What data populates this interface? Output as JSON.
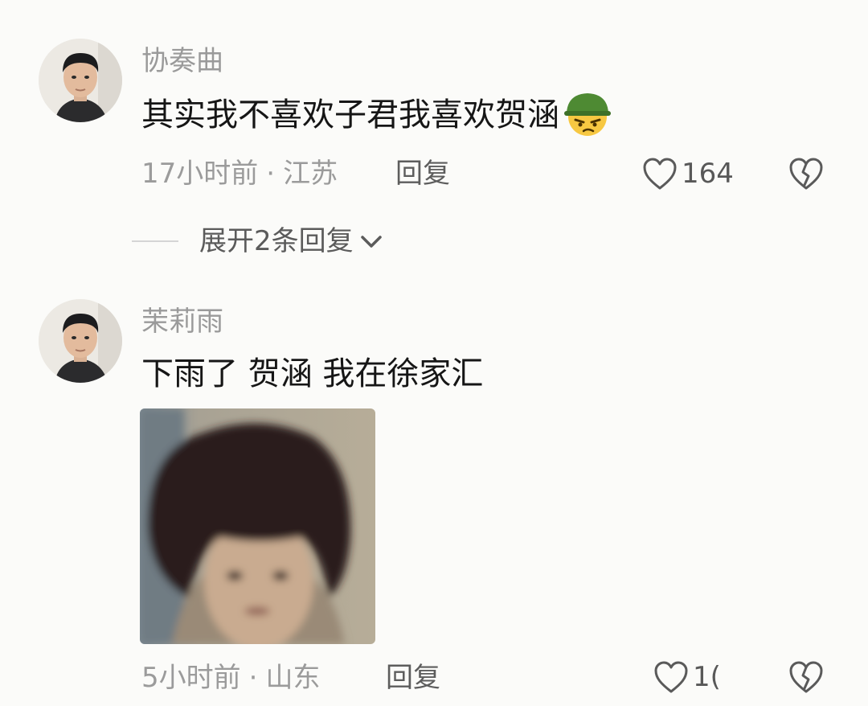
{
  "comments": [
    {
      "username": "协奏曲",
      "text": "其实我不喜欢子君我喜欢贺涵",
      "emoji": "soldier-helmet-frowning-emoji",
      "time": "17小时前",
      "location": "江苏",
      "reply_label": "回复",
      "like_count": "164",
      "expand_label": "展开2条回复"
    },
    {
      "username": "茉莉雨",
      "text": "下雨了 贺涵 我在徐家汇",
      "attachment": "photo-person-with-bob-haircut",
      "time": "5小时前",
      "location": "山东",
      "reply_label": "回复",
      "like_count": "1("
    }
  ],
  "separator": "·",
  "icons": {
    "like": "heart-outline-icon",
    "dislike": "broken-heart-icon",
    "expand": "chevron-down-icon"
  },
  "colors": {
    "background": "#fbfbf9",
    "username": "#9a9a9a",
    "text": "#161616",
    "meta": "#9b9b9b"
  }
}
